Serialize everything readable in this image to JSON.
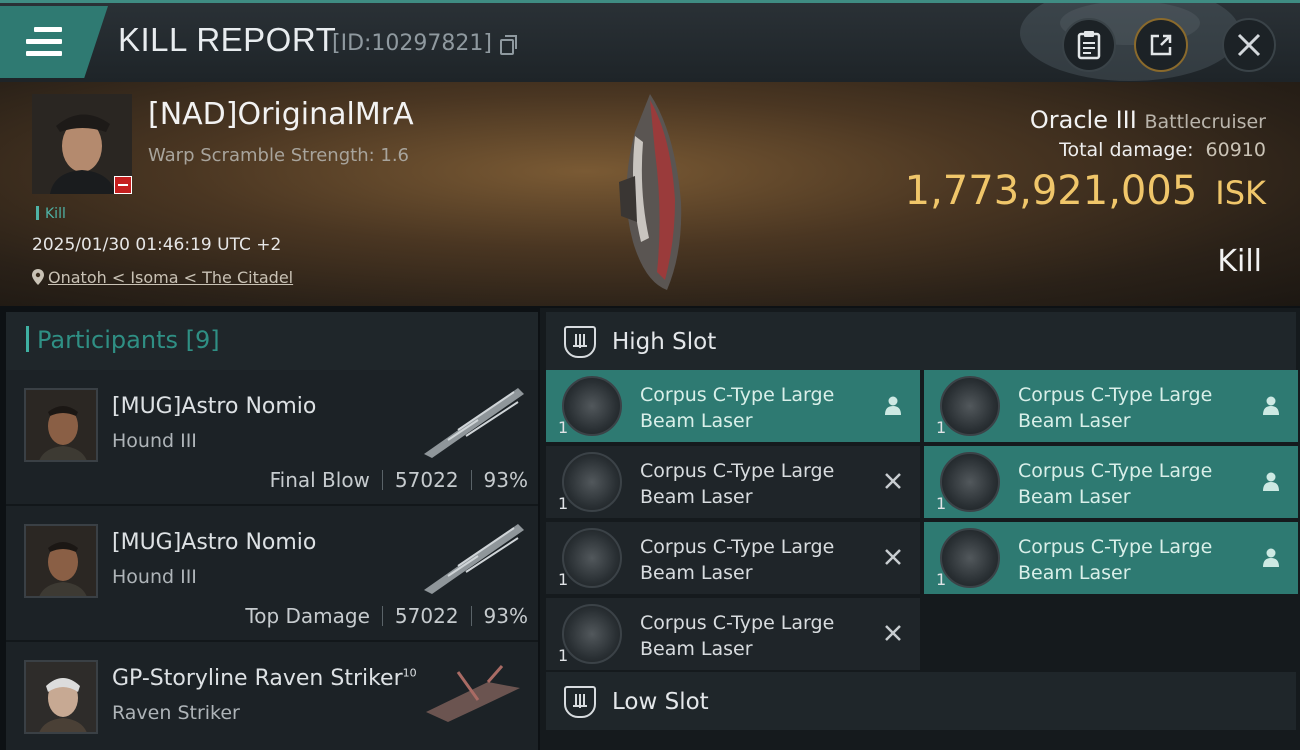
{
  "header": {
    "title": "KILL REPORT",
    "report_id": "[ID:10297821]",
    "icons": {
      "menu": "hamburger-menu-icon",
      "copy": "copy-icon",
      "clipboard": "clipboard-icon",
      "share": "share-icon",
      "close": "close-icon"
    }
  },
  "victim": {
    "name": "[NAD]OriginalMrA",
    "warp_scramble": "Warp Scramble Strength: 1.6",
    "tag": "Kill",
    "timestamp": "2025/01/30 01:46:19 UTC +2",
    "location": "Onatoh < Isoma < The Citadel",
    "ship": "Oracle III",
    "ship_class": "Battlecruiser",
    "total_damage_label": "Total damage:",
    "total_damage": "60910",
    "isk_value": "1,773,921,005",
    "isk_unit": "ISK",
    "result": "Kill"
  },
  "participants": {
    "title": "Participants",
    "count": "[9]",
    "rows": [
      {
        "name": "[MUG]Astro Nomio",
        "superscript": "",
        "ship": "Hound III",
        "role": "Final Blow",
        "damage": "57022",
        "percent": "93%"
      },
      {
        "name": "[MUG]Astro Nomio",
        "superscript": "",
        "ship": "Hound III",
        "role": "Top Damage",
        "damage": "57022",
        "percent": "93%"
      },
      {
        "name": "GP-Storyline Raven Striker",
        "superscript": "10",
        "ship": "Raven Striker",
        "role": "",
        "damage": "",
        "percent": ""
      }
    ]
  },
  "fitting": {
    "high_slot_label": "High Slot",
    "low_slot_label": "Low Slot",
    "high_slots": [
      {
        "name": "Corpus C-Type Large Beam Laser",
        "qty": "1",
        "status": "person-icon",
        "state": "dropped"
      },
      {
        "name": "Corpus C-Type Large Beam Laser",
        "qty": "1",
        "status": "person-icon",
        "state": "dropped"
      },
      {
        "name": "Corpus C-Type Large Beam Laser",
        "qty": "1",
        "status": "destroyed-x-icon",
        "state": "destroyed"
      },
      {
        "name": "Corpus C-Type Large Beam Laser",
        "qty": "1",
        "status": "person-icon",
        "state": "dropped"
      },
      {
        "name": "Corpus C-Type Large Beam Laser",
        "qty": "1",
        "status": "destroyed-x-icon",
        "state": "destroyed"
      },
      {
        "name": "Corpus C-Type Large Beam Laser",
        "qty": "1",
        "status": "person-icon",
        "state": "dropped"
      },
      {
        "name": "Corpus C-Type Large Beam Laser",
        "qty": "1",
        "status": "destroyed-x-icon",
        "state": "destroyed"
      }
    ]
  },
  "colors": {
    "accent": "#2e7a72",
    "isk": "#f0c66a",
    "participants_title": "#2f8f84"
  }
}
